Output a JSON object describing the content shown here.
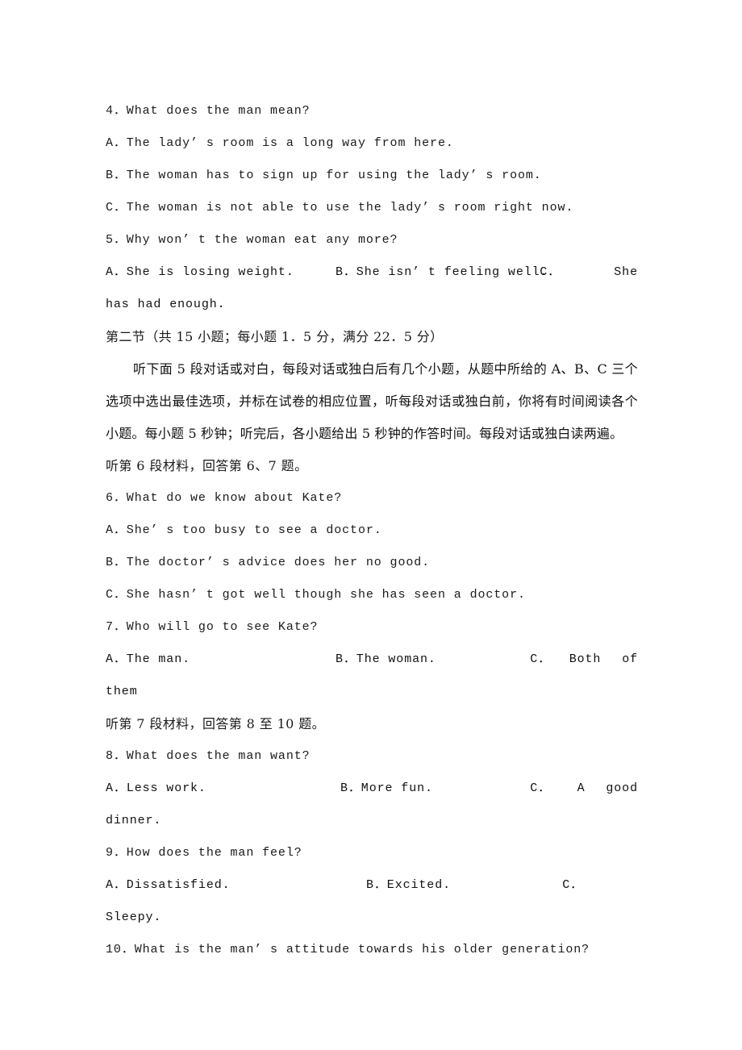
{
  "document": {
    "type": "exam-paper",
    "language": "zh-CN/en",
    "page_background": "#ffffff",
    "text_color": "#1a1a1a"
  },
  "questions": {
    "q4": {
      "stem": "4．What does the man mean?",
      "a": "A．The lady’ s room is a long way from here.",
      "b": "B．The woman has to sign up for using the lady’ s room.",
      "c": "C．The woman is not able to use the lady’ s room right now."
    },
    "q5": {
      "stem": "5．Why won’ t the woman eat any more?",
      "a": "A．She is losing weight.",
      "b": "B．She isn’ t feeling well.",
      "c": "C．",
      "c_tail": "She",
      "c_wrap": "has had enough."
    },
    "q6": {
      "stem": "6．What do we know about Kate?",
      "a": "A．She’ s too busy to see a doctor.",
      "b": "B．The doctor’ s advice does her no good.",
      "c": "C．She hasn’ t got well though she has seen a doctor."
    },
    "q7": {
      "stem": "7．Who will go to see Kate?",
      "a": "A．The man.",
      "b": "B．The woman.",
      "c": "C．",
      "c_tail": "Both of",
      "c_wrap": "them"
    },
    "q8": {
      "stem": "8．What does the man want?",
      "a": "A．Less work.",
      "b": "B．More fun.",
      "c": "C．",
      "c_tail": "A good",
      "c_wrap": "dinner."
    },
    "q9": {
      "stem": "9．How does the man feel?",
      "a": "A．Dissatisfied.",
      "b": "B．Excited.",
      "c": "C．",
      "c_tail": "",
      "c_wrap": "Sleepy."
    },
    "q10": {
      "stem": "10．What is the man’ s attitude towards his older generation?"
    }
  },
  "section_two": {
    "heading": "第二节（共 15 小题；每小题 1．5 分，满分 22．5 分）",
    "instructions": "听下面 5 段对话或对白，每段对话或独白后有几个小题，从题中所给的 A、B、C 三个选项中选出最佳选项，并标在试卷的相应位置，听每段对话或独白前，你将有时间阅读各个小题。每小题 5 秒钟；听完后，各小题给出 5 秒钟的作答时间。每段对话或独白读两遍。",
    "cue_6_7": "听第 6 段材料，回答第 6、7 题。",
    "cue_8_10": "听第 7 段材料，回答第 8 至 10 题。"
  }
}
